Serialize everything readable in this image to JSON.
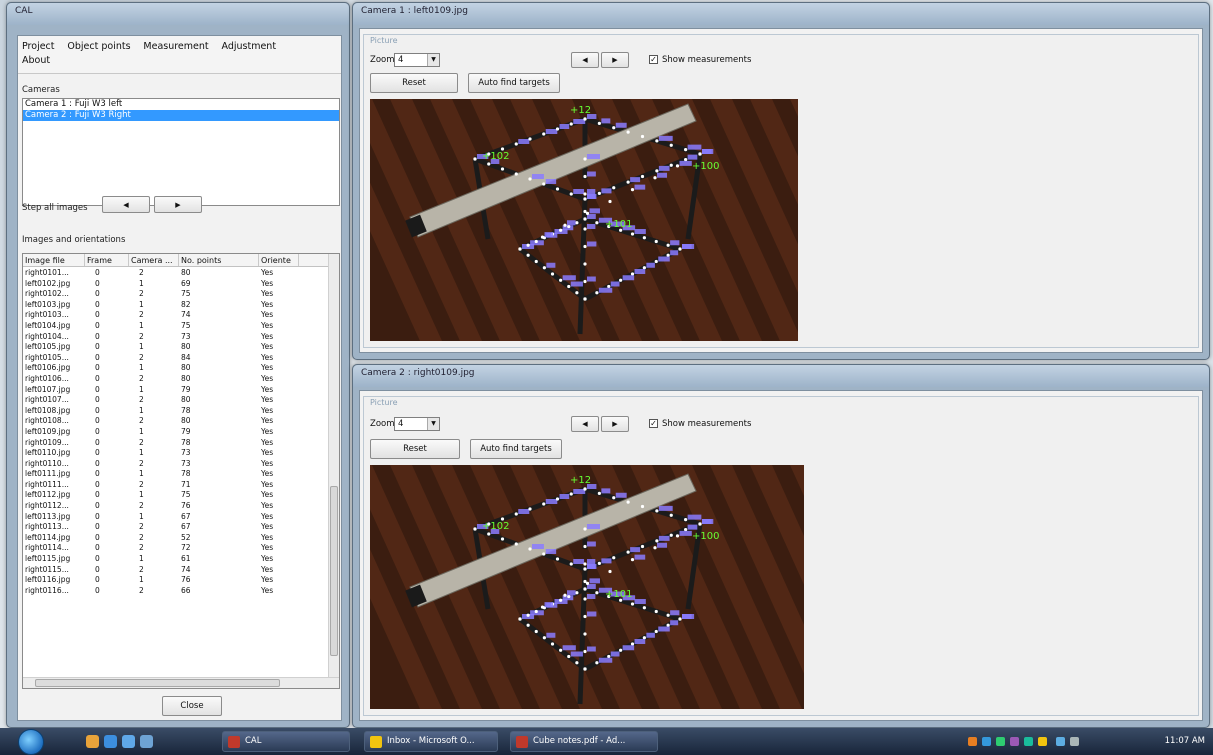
{
  "cal_window": {
    "title": "CAL",
    "menu": [
      "Project",
      "Object points",
      "Measurement",
      "Adjustment",
      "About"
    ],
    "cameras_label": "Cameras",
    "cameras": [
      "Camera 1 : Fuji W3 left",
      "Camera 2 : Fuji W3 Right"
    ],
    "selected_camera_index": 1,
    "step_label": "Step all images",
    "images_label": "Images and orientations",
    "columns": [
      "Image file",
      "Frame",
      "Camera ...",
      "No. points",
      "Oriente"
    ],
    "rows": [
      [
        "right0101...",
        "0",
        "2",
        "80",
        "Yes"
      ],
      [
        "left0102.jpg",
        "0",
        "1",
        "69",
        "Yes"
      ],
      [
        "right0102...",
        "0",
        "2",
        "75",
        "Yes"
      ],
      [
        "left0103.jpg",
        "0",
        "1",
        "82",
        "Yes"
      ],
      [
        "right0103...",
        "0",
        "2",
        "74",
        "Yes"
      ],
      [
        "left0104.jpg",
        "0",
        "1",
        "75",
        "Yes"
      ],
      [
        "right0104...",
        "0",
        "2",
        "73",
        "Yes"
      ],
      [
        "left0105.jpg",
        "0",
        "1",
        "80",
        "Yes"
      ],
      [
        "right0105...",
        "0",
        "2",
        "84",
        "Yes"
      ],
      [
        "left0106.jpg",
        "0",
        "1",
        "80",
        "Yes"
      ],
      [
        "right0106...",
        "0",
        "2",
        "80",
        "Yes"
      ],
      [
        "left0107.jpg",
        "0",
        "1",
        "79",
        "Yes"
      ],
      [
        "right0107...",
        "0",
        "2",
        "80",
        "Yes"
      ],
      [
        "left0108.jpg",
        "0",
        "1",
        "78",
        "Yes"
      ],
      [
        "right0108...",
        "0",
        "2",
        "80",
        "Yes"
      ],
      [
        "left0109.jpg",
        "0",
        "1",
        "79",
        "Yes"
      ],
      [
        "right0109...",
        "0",
        "2",
        "78",
        "Yes"
      ],
      [
        "left0110.jpg",
        "0",
        "1",
        "73",
        "Yes"
      ],
      [
        "right0110...",
        "0",
        "2",
        "73",
        "Yes"
      ],
      [
        "left0111.jpg",
        "0",
        "1",
        "78",
        "Yes"
      ],
      [
        "right0111...",
        "0",
        "2",
        "71",
        "Yes"
      ],
      [
        "left0112.jpg",
        "0",
        "1",
        "75",
        "Yes"
      ],
      [
        "right0112...",
        "0",
        "2",
        "76",
        "Yes"
      ],
      [
        "left0113.jpg",
        "0",
        "1",
        "67",
        "Yes"
      ],
      [
        "right0113...",
        "0",
        "2",
        "67",
        "Yes"
      ],
      [
        "left0114.jpg",
        "0",
        "2",
        "52",
        "Yes"
      ],
      [
        "right0114...",
        "0",
        "2",
        "72",
        "Yes"
      ],
      [
        "left0115.jpg",
        "0",
        "1",
        "61",
        "Yes"
      ],
      [
        "right0115...",
        "0",
        "2",
        "74",
        "Yes"
      ],
      [
        "left0116.jpg",
        "0",
        "1",
        "76",
        "Yes"
      ],
      [
        "right0116...",
        "0",
        "2",
        "66",
        "Yes"
      ]
    ],
    "close_label": "Close"
  },
  "camera1": {
    "title": "Camera 1 : left0109.jpg",
    "group_label": "Picture",
    "zoom_label": "Zoom",
    "zoom_value": "4",
    "reset_label": "Reset",
    "auto_label": "Auto find targets",
    "show_label": "Show measurements",
    "show_checked": true
  },
  "camera2": {
    "title": "Camera 2 : right0109.jpg",
    "group_label": "Picture",
    "zoom_label": "Zoom",
    "zoom_value": "4",
    "reset_label": "Reset",
    "auto_label": "Auto find targets",
    "show_label": "Show measurements",
    "show_checked": true
  },
  "photo_labels": [
    "12",
    "102",
    "100",
    "101"
  ],
  "taskbar": {
    "tasks": [
      {
        "label": "CAL",
        "icon_color": "#c0392b"
      },
      {
        "label": "Inbox - Microsoft O...",
        "icon_color": "#f1c40f"
      },
      {
        "label": "Cube notes.pdf - Ad...",
        "icon_color": "#c0392b"
      }
    ],
    "clock": "11:07 AM"
  },
  "colors": {
    "selection": "#3399ff",
    "target_label_green": "#66ff33",
    "target_label_blue": "#8a7bff",
    "wood_dark": "#3b1d10",
    "wood_light": "#7a3d1f"
  }
}
